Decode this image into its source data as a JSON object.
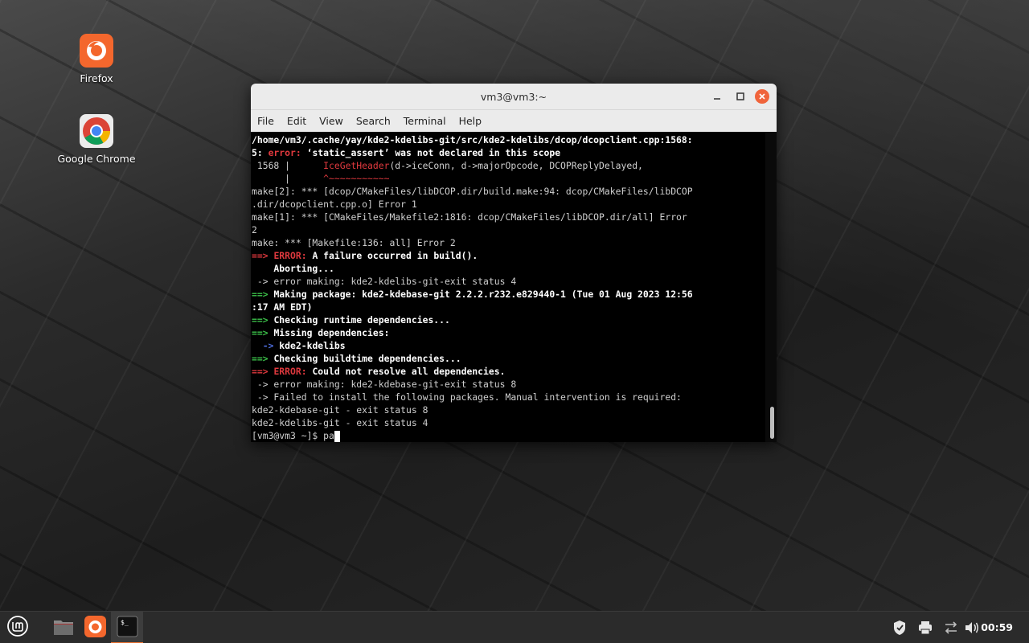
{
  "desktop": {
    "icons": [
      {
        "label": "Firefox",
        "icon": "firefox-icon"
      },
      {
        "label": "Google Chrome",
        "icon": "chrome-icon"
      }
    ]
  },
  "terminal": {
    "title": "vm3@vm3:~",
    "menu": [
      "File",
      "Edit",
      "View",
      "Search",
      "Terminal",
      "Help"
    ],
    "lines": {
      "l1": "/home/vm3/.cache/yay/kde2-kdelibs-git/src/kde2-kdelibs/dcop/dcopclient.cpp:1568:",
      "l2a": "5: ",
      "l2b": "error: ",
      "l2c": "‘static_assert’ was not declared in this scope",
      "l3a": " 1568 |      ",
      "l3b": "IceGetHeader",
      "l3c": "(d->iceConn, d->majorOpcode, DCOPReplyDelayed,",
      "l4a": "      |      ",
      "l4b": "^~~~~~~~~~~~",
      "l5": "make[2]: *** [dcop/CMakeFiles/libDCOP.dir/build.make:94: dcop/CMakeFiles/libDCOP",
      "l6": ".dir/dcopclient.cpp.o] Error 1",
      "l7": "make[1]: *** [CMakeFiles/Makefile2:1816: dcop/CMakeFiles/libDCOP.dir/all] Error",
      "l8": "2",
      "l9": "make: *** [Makefile:136: all] Error 2",
      "l10a": "==> ",
      "l10b": "ERROR: ",
      "l10c": "A failure occurred in build().",
      "l11": "    Aborting...",
      "l12": " -> error making: kde2-kdelibs-git-exit status 4",
      "l13a": "==> ",
      "l13b": "Making package: kde2-kdebase-git 2.2.2.r232.e829440-1 (Tue 01 Aug 2023 12:56",
      "l14": ":17 AM EDT)",
      "l15a": "==> ",
      "l15b": "Checking runtime dependencies...",
      "l16a": "==> ",
      "l16b": "Missing dependencies:",
      "l17a": "  -> ",
      "l17b": "kde2-kdelibs",
      "l18a": "==> ",
      "l18b": "Checking buildtime dependencies...",
      "l19a": "==> ",
      "l19b": "ERROR: ",
      "l19c": "Could not resolve all dependencies.",
      "l20": " -> error making: kde2-kdebase-git-exit status 8",
      "l21": " -> Failed to install the following packages. Manual intervention is required:",
      "l22": "kde2-kdebase-git - exit status 8",
      "l23": "kde2-kdelibs-git - exit status 4",
      "l24a": "[vm3@vm3 ~]$ ",
      "l24b": "pa"
    }
  },
  "taskbar": {
    "clock": "00:59",
    "items": [
      "mint-menu-icon",
      "files-icon",
      "firefox-icon",
      "terminal-icon"
    ],
    "tray": [
      "shield-icon",
      "printer-icon",
      "network-icon",
      "volume-icon"
    ],
    "accent": "#e86f2e"
  }
}
